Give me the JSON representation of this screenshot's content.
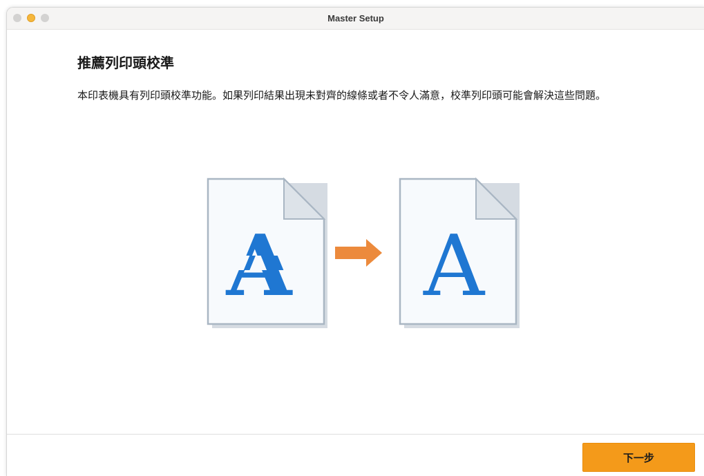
{
  "window": {
    "title": "Master Setup",
    "controls": [
      "close",
      "minimize",
      "zoom"
    ]
  },
  "content": {
    "heading": "推薦列印頭校準",
    "description": "本印表機具有列印頭校準功能。如果列印結果出現未對齊的線條或者不令人滿意，校準列印頭可能會解決這些問題。"
  },
  "illustration": {
    "before_letter": "A",
    "after_letter": "A",
    "letter_color": "#1f77d2",
    "arrow_color": "#ec8a3c",
    "paper_border_color": "#a9b6c3"
  },
  "footer": {
    "next_label": "下一步",
    "next_color": "#f49a1a"
  }
}
